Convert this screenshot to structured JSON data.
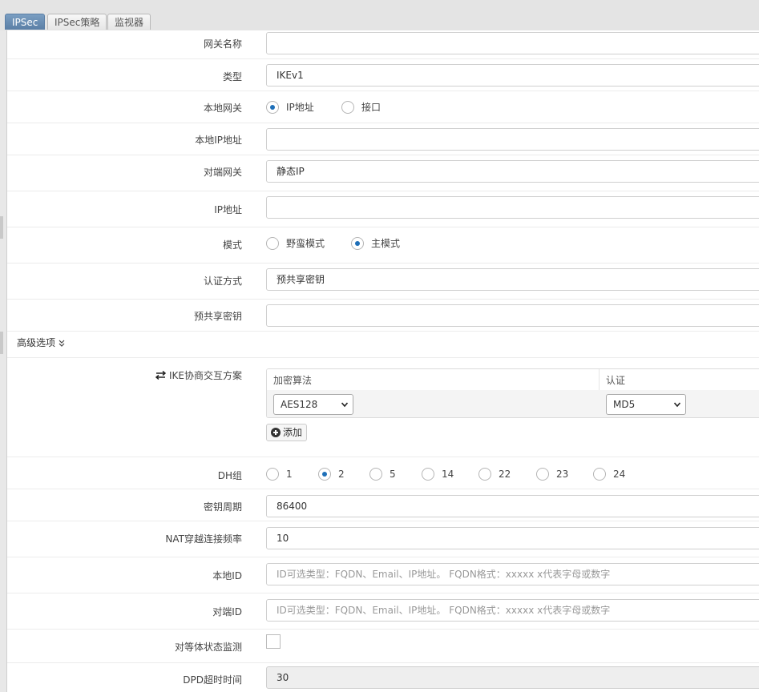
{
  "tabs": [
    {
      "label": "IPSec",
      "active": true
    },
    {
      "label": "IPSec策略",
      "active": false
    },
    {
      "label": "监视器",
      "active": false
    }
  ],
  "form": {
    "gateway_name": {
      "label": "网关名称",
      "value": ""
    },
    "type": {
      "label": "类型",
      "value": "IKEv1"
    },
    "local_gateway": {
      "label": "本地网关",
      "options": [
        "IP地址",
        "接口"
      ],
      "selected": "IP地址"
    },
    "local_ip": {
      "label": "本地IP地址",
      "value": ""
    },
    "peer_gateway": {
      "label": "对端网关",
      "value": "静态IP"
    },
    "ip_address": {
      "label": "IP地址",
      "value": ""
    },
    "mode": {
      "label": "模式",
      "options": [
        "野蛮模式",
        "主模式"
      ],
      "selected": "主模式"
    },
    "auth_method": {
      "label": "认证方式",
      "value": "预共享密钥"
    },
    "psk": {
      "label": "预共享密钥",
      "value": ""
    },
    "advanced": {
      "label": "高级选项",
      "toggle_icon": "double-chevron-down-icon"
    },
    "ike_proposal": {
      "label": "IKE协商交互方案",
      "icon": "exchange-arrows-icon",
      "columns": [
        "加密算法",
        "认证"
      ],
      "rows": [
        {
          "encryption": "AES128",
          "auth": "MD5"
        }
      ],
      "add_label": "添加"
    },
    "dh_group": {
      "label": "DH组",
      "options": [
        "1",
        "2",
        "5",
        "14",
        "22",
        "23",
        "24"
      ],
      "selected": "2"
    },
    "key_lifetime": {
      "label": "密钥周期",
      "value": "86400"
    },
    "nat_keepalive": {
      "label": "NAT穿越连接频率",
      "value": "10"
    },
    "local_id": {
      "label": "本地ID",
      "value": "",
      "placeholder": "ID可选类型：FQDN、Email、IP地址。 FQDN格式：xxxxx x代表字母或数字"
    },
    "peer_id": {
      "label": "对端ID",
      "value": "",
      "placeholder": "ID可选类型：FQDN、Email、IP地址。 FQDN格式：xxxxx x代表字母或数字"
    },
    "dpd": {
      "label": "对等体状态监测",
      "checked": false
    },
    "dpd_timeout": {
      "label": "DPD超时时间",
      "value": "30"
    }
  },
  "colors": {
    "tab_active": "#5b7fa6",
    "radio_checked": "#1e6fb8",
    "field_border": "#cfcfcf",
    "disabled_field": "#eeeeee"
  }
}
